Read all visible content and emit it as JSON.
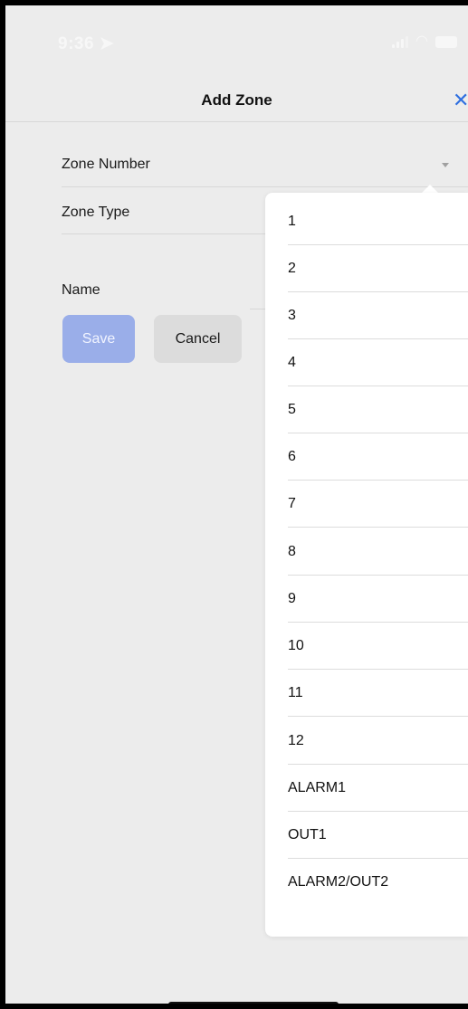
{
  "status": {
    "time": "9:36"
  },
  "header": {
    "title": "Add Zone",
    "close": "✕"
  },
  "form": {
    "zone_number_label": "Zone Number",
    "zone_type_label": "Zone Type",
    "name_label": "Name",
    "save_label": "Save",
    "cancel_label": "Cancel"
  },
  "dropdown": {
    "options": [
      "1",
      "2",
      "3",
      "4",
      "5",
      "6",
      "7",
      "8",
      "9",
      "10",
      "11",
      "12",
      "ALARM1",
      "OUT1",
      "ALARM2/OUT2"
    ]
  },
  "icons": {
    "location": "location-arrow-icon",
    "signal": "cellular-signal-icon",
    "wifi": "wifi-icon",
    "battery": "battery-icon",
    "close": "close-icon",
    "dropdown": "chevron-down-icon"
  },
  "colors": {
    "accent": "#2f6fe0",
    "save_disabled": "#9aaee9"
  }
}
